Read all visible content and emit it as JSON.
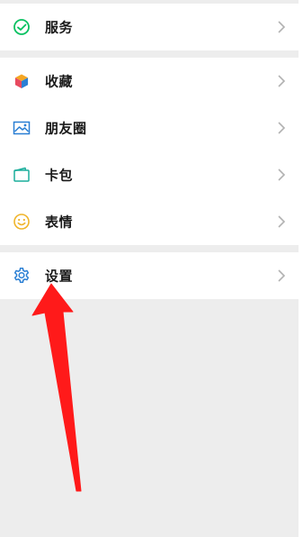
{
  "menu": {
    "service": {
      "label": "服务",
      "icon": "wechat-pay-icon",
      "color": "#07c160"
    },
    "favorites": {
      "label": "收藏",
      "icon": "cube-icon",
      "color": "#f5a623"
    },
    "moments": {
      "label": "朋友圈",
      "icon": "image-icon",
      "color": "#2a7fd4"
    },
    "cards": {
      "label": "卡包",
      "icon": "wallet-icon",
      "color": "#1aad9b"
    },
    "stickers": {
      "label": "表情",
      "icon": "smiley-icon",
      "color": "#f0b429"
    },
    "settings": {
      "label": "设置",
      "icon": "gear-icon",
      "color": "#2a7fd4"
    }
  },
  "annotation": {
    "type": "red-arrow",
    "color": "#ff1a1a",
    "points_to": "设置"
  }
}
